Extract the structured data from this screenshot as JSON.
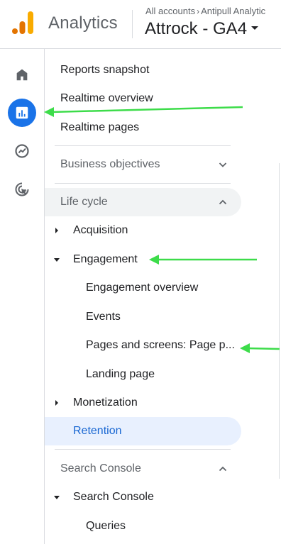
{
  "header": {
    "brand": "Analytics",
    "breadcrumb": {
      "part1": "All accounts",
      "part2": "Antipull Analytic"
    },
    "property_name": "Attrock - GA4"
  },
  "rail": {
    "items": [
      {
        "icon": "home-icon"
      },
      {
        "icon": "reports-icon",
        "active": true
      },
      {
        "icon": "explore-icon"
      },
      {
        "icon": "advertising-icon"
      }
    ]
  },
  "nav": {
    "reports_snapshot": "Reports snapshot",
    "realtime_overview": "Realtime overview",
    "realtime_pages": "Realtime pages",
    "business_objectives": "Business objectives",
    "life_cycle": "Life cycle",
    "acquisition": "Acquisition",
    "engagement": "Engagement",
    "engagement_overview": "Engagement overview",
    "events": "Events",
    "pages_and_screens": "Pages and screens: Page p...",
    "landing_page": "Landing page",
    "monetization": "Monetization",
    "retention": "Retention",
    "search_console_section": "Search Console",
    "search_console": "Search Console",
    "queries": "Queries"
  },
  "colors": {
    "accent": "#1a73e8",
    "selected_bg": "#e8f0fe",
    "selected_text": "#1967d2",
    "annotation_arrow": "#3ddc4a",
    "logo_orange": "#f9ab00",
    "logo_dark_orange": "#e37400"
  }
}
